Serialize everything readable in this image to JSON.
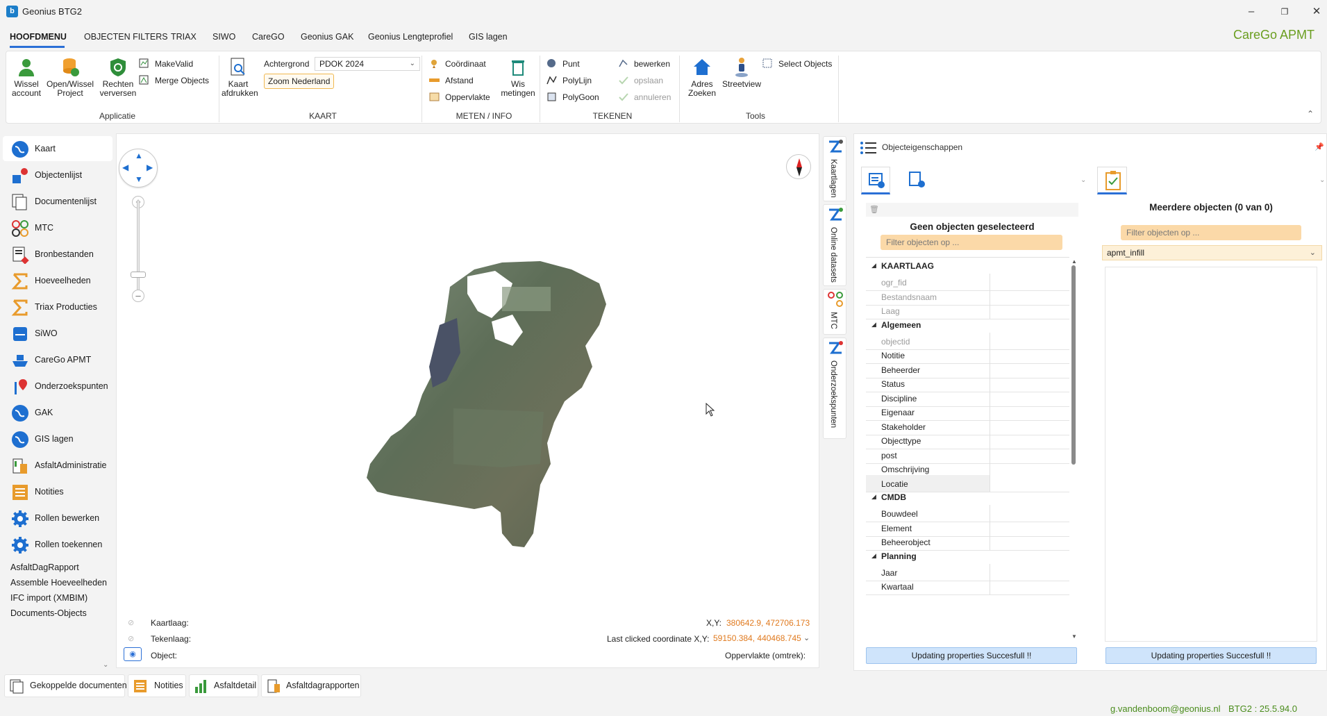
{
  "window": {
    "title": "Geonius BTG2",
    "brand": "CareGo APMT"
  },
  "menu": [
    "HOOFDMENU",
    "OBJECTEN FILTERS",
    "TRIAX",
    "SIWO",
    "CareGO",
    "Geonius GAK",
    "Geonius Lengteprofiel",
    "GIS lagen"
  ],
  "ribbon": {
    "applicatie": {
      "label": "Applicatie",
      "wissel": "Wissel account",
      "wissel_l1": "Wissel",
      "wissel_l2": "account",
      "open_l1": "Open/Wissel",
      "open_l2": "Project",
      "rechten_l1": "Rechten",
      "rechten_l2": "verversen",
      "makevalid": "MakeValid",
      "merge": "Merge Objects"
    },
    "kaart": {
      "label": "KAART",
      "afdrukken_l1": "Kaart",
      "afdrukken_l2": "afdrukken",
      "achtergrond_label": "Achtergrond",
      "achtergrond_value": "PDOK 2024",
      "zoom": "Zoom Nederland"
    },
    "meten": {
      "label": "METEN / INFO",
      "coordinaat": "Coördinaat",
      "afstand": "Afstand",
      "oppervlakte": "Oppervlakte",
      "wis_l1": "Wis",
      "wis_l2": "metingen"
    },
    "tekenen": {
      "label": "TEKENEN",
      "punt": "Punt",
      "polylijn": "PolyLijn",
      "polygoon": "PolyGoon",
      "bewerken": "bewerken",
      "opslaan": "opslaan",
      "annuleren": "annuleren"
    },
    "tools": {
      "label": "Tools",
      "adres_l1": "Adres",
      "adres_l2": "Zoeken",
      "streetview": "Streetview",
      "select": "Select Objects"
    }
  },
  "sidebar": {
    "items": [
      "Kaart",
      "Objectenlijst",
      "Documentenlijst",
      "MTC",
      "Bronbestanden",
      "Hoeveelheden",
      "Triax Producties",
      "SiWO",
      "CareGo APMT",
      "Onderzoekspunten",
      "GAK",
      "GIS lagen",
      "AsfaltAdministratie",
      "Notities",
      "Rollen bewerken",
      "Rollen toekennen"
    ],
    "links": [
      "AsfaltDagRapport",
      "Assemble Hoeveelheden",
      "IFC import (XMBIM)",
      "Documents-Objects"
    ]
  },
  "map_status": {
    "kaartlaag_label": "Kaartlaag:",
    "tekenlaag_label": "Tekenlaag:",
    "object_label": "Object:",
    "xy_label": "X,Y:",
    "xy_value": "380642.9, 472706.173",
    "last_label": "Last clicked coordinate X,Y:",
    "last_value": "59150.384, 440468.745",
    "oppervlakte_label": "Oppervlakte (omtrek):"
  },
  "vtabs": [
    "Kaartlagen",
    "Online datasets",
    "MTC",
    "Onderzoekspunten"
  ],
  "panel": {
    "title": "Objecteigenschappen",
    "left_heading": "Geen objecten geselecteerd",
    "filter_placeholder": "Filter objecten op ...",
    "categories": [
      {
        "name": "KAARTLAAG",
        "props": [
          {
            "k": "ogr_fid",
            "dim": true
          },
          {
            "k": "Bestandsnaam",
            "dim": true
          },
          {
            "k": "Laag",
            "dim": true
          }
        ]
      },
      {
        "name": "Algemeen",
        "props": [
          {
            "k": "objectid",
            "dim": true
          },
          {
            "k": "Notitie"
          },
          {
            "k": "Beheerder"
          },
          {
            "k": "Status"
          },
          {
            "k": "Discipline"
          },
          {
            "k": "Eigenaar"
          },
          {
            "k": "Stakeholder"
          },
          {
            "k": "Objecttype"
          },
          {
            "k": "post"
          },
          {
            "k": "Omschrijving"
          },
          {
            "k": "Locatie"
          }
        ]
      },
      {
        "name": "CMDB",
        "props": [
          {
            "k": "Bouwdeel"
          },
          {
            "k": "Element"
          },
          {
            "k": "Beheerobject"
          }
        ]
      },
      {
        "name": "Planning",
        "props": [
          {
            "k": "Jaar"
          },
          {
            "k": "Kwartaal"
          }
        ]
      }
    ],
    "right_heading": "Meerdere objecten (0 van 0)",
    "right_filter_placeholder": "Filter objecten op ...",
    "layer_select": "apmt_infill",
    "status_left": "Updating properties Succesfull !!",
    "status_right": "Updating properties Succesfull !!"
  },
  "bottom_tabs": [
    "Gekoppelde documenten",
    "Notities",
    "Asfaltdetail",
    "Asfaltdagrapporten"
  ],
  "footer": {
    "user": "g.vandenboom@geonius.nl",
    "version": "BTG2 : 25.5.94.0"
  }
}
